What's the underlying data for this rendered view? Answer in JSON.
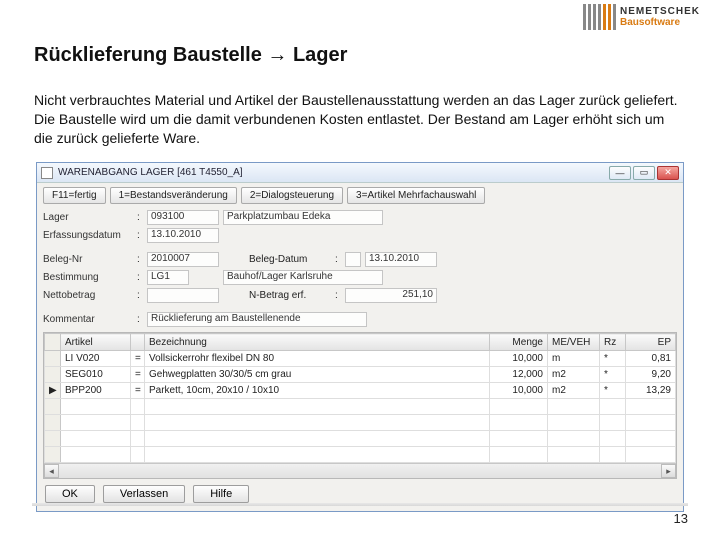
{
  "brand": {
    "line1": "NEMETSCHEK",
    "line2": "Bausoftware"
  },
  "title": "Rücklieferung Baustelle → Lager",
  "description": "Nicht verbrauchtes Material und Artikel der Baustellenausstattung werden an das Lager zurück geliefert. Die Baustelle wird um die damit verbundenen Kosten entlastet. Der Bestand am Lager erhöht sich um die zurück gelieferte Ware.",
  "window": {
    "title": "WARENABGANG LAGER  [461  T4550_A]",
    "tabs": [
      "F11=fertig",
      "1=Bestandsveränderung",
      "2=Dialogsteuerung",
      "3=Artikel Mehrfachauswahl"
    ],
    "fields": {
      "lager_label": "Lager",
      "lager_code": "093100",
      "lager_name": "Parkplatzumbau Edeka",
      "erf_label": "Erfassungsdatum",
      "erf_val": "13.10.2010",
      "belegnr_label": "Beleg-Nr",
      "belegnr_val": "2010007",
      "belegdat_label": "Beleg-Datum",
      "belegdat_val": "13.10.2010",
      "best_label": "Bestimmung",
      "best_code": "LG1",
      "best_name": "Bauhof/Lager Karlsruhe",
      "netto_label": "Nettobetrag",
      "nbetr_label": "N-Betrag erf.",
      "nbetr_val": "251,10",
      "komm_label": "Kommentar",
      "komm_val": "Rücklieferung am Baustellenende"
    },
    "table": {
      "headers": [
        "",
        "Artikel",
        "",
        "Bezeichnung",
        "Menge",
        "ME/VEH",
        "Rz",
        "EP"
      ],
      "rows": [
        {
          "mark": "",
          "artikel": "LI V020",
          "bez": "Vollsickerrohr flexibel DN 80",
          "menge": "10,000",
          "me": "m",
          "rz": "*",
          "ep": "0,81"
        },
        {
          "mark": "",
          "artikel": "SEG010",
          "bez": "Gehwegplatten 30/30/5 cm grau",
          "menge": "12,000",
          "me": "m2",
          "rz": "*",
          "ep": "9,20"
        },
        {
          "mark": "▶",
          "artikel": "BPP200",
          "bez": "Parkett, 10cm, 20x10 / 10x10",
          "menge": "10,000",
          "me": "m2",
          "rz": "*",
          "ep": "13,29"
        }
      ],
      "blank_rows": 4
    },
    "buttons": {
      "ok": "OK",
      "verlassen": "Verlassen",
      "hilfe": "Hilfe"
    }
  },
  "page_number": "13"
}
